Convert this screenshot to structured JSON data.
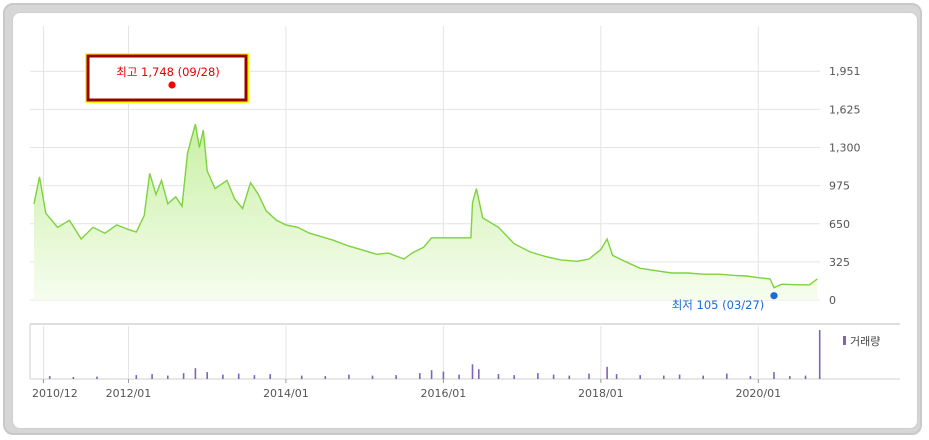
{
  "chart_data": [
    {
      "type": "area",
      "title": "",
      "xlabel": "",
      "ylabel": "",
      "ylim": [
        0,
        1951
      ],
      "y_ticks": [
        "1,951",
        "1,625",
        "1,300",
        "975",
        "650",
        "325",
        "0"
      ],
      "y_tick_values": [
        1951,
        1625,
        1300,
        975,
        650,
        325,
        0
      ],
      "grid": true,
      "colors": {
        "line": "#7ed23e",
        "fill_top": "#c9f0a4",
        "fill_bottom": "#f6fdef",
        "grid": "#e4e4e4"
      },
      "series": [
        {
          "values": [
            [
              2010.8,
              820
            ],
            [
              2010.87,
              1050
            ],
            [
              2010.95,
              740
            ],
            [
              2011.1,
              620
            ],
            [
              2011.25,
              680
            ],
            [
              2011.4,
              520
            ],
            [
              2011.55,
              620
            ],
            [
              2011.7,
              570
            ],
            [
              2011.85,
              640
            ],
            [
              2012.0,
              600
            ],
            [
              2012.1,
              580
            ],
            [
              2012.2,
              720
            ],
            [
              2012.27,
              1080
            ],
            [
              2012.35,
              900
            ],
            [
              2012.42,
              1020
            ],
            [
              2012.5,
              820
            ],
            [
              2012.6,
              880
            ],
            [
              2012.68,
              800
            ],
            [
              2012.75,
              1250
            ],
            [
              2012.8,
              1380
            ],
            [
              2012.85,
              1500
            ],
            [
              2012.9,
              1300
            ],
            [
              2012.95,
              1450
            ],
            [
              2013.0,
              1100
            ],
            [
              2013.1,
              950
            ],
            [
              2013.25,
              1020
            ],
            [
              2013.35,
              860
            ],
            [
              2013.45,
              780
            ],
            [
              2013.55,
              1000
            ],
            [
              2013.65,
              900
            ],
            [
              2013.75,
              760
            ],
            [
              2013.88,
              680
            ],
            [
              2014.0,
              640
            ],
            [
              2014.15,
              620
            ],
            [
              2014.3,
              570
            ],
            [
              2014.45,
              540
            ],
            [
              2014.6,
              510
            ],
            [
              2014.8,
              460
            ],
            [
              2015.0,
              420
            ],
            [
              2015.15,
              390
            ],
            [
              2015.3,
              400
            ],
            [
              2015.5,
              350
            ],
            [
              2015.6,
              400
            ],
            [
              2015.75,
              450
            ],
            [
              2015.85,
              530
            ],
            [
              2016.0,
              530
            ],
            [
              2016.2,
              530
            ],
            [
              2016.35,
              530
            ],
            [
              2016.37,
              830
            ],
            [
              2016.42,
              950
            ],
            [
              2016.5,
              700
            ],
            [
              2016.7,
              620
            ],
            [
              2016.9,
              480
            ],
            [
              2017.1,
              410
            ],
            [
              2017.3,
              370
            ],
            [
              2017.5,
              340
            ],
            [
              2017.7,
              330
            ],
            [
              2017.85,
              350
            ],
            [
              2018.0,
              430
            ],
            [
              2018.08,
              520
            ],
            [
              2018.15,
              380
            ],
            [
              2018.3,
              330
            ],
            [
              2018.5,
              270
            ],
            [
              2018.7,
              250
            ],
            [
              2018.9,
              230
            ],
            [
              2019.1,
              230
            ],
            [
              2019.3,
              220
            ],
            [
              2019.5,
              220
            ],
            [
              2019.7,
              210
            ],
            [
              2019.85,
              205
            ],
            [
              2020.0,
              190
            ],
            [
              2020.15,
              180
            ],
            [
              2020.2,
              105
            ],
            [
              2020.3,
              135
            ],
            [
              2020.5,
              130
            ],
            [
              2020.65,
              130
            ],
            [
              2020.75,
              180
            ]
          ]
        }
      ],
      "annotations": [
        {
          "text": "최고 1,748 (09/28)",
          "x": 2012.83,
          "y": 1748,
          "color": "#e60000"
        },
        {
          "text": "최저 105 (03/27)",
          "x": 2020.2,
          "y": 105,
          "color": "#1a6bd6"
        }
      ]
    },
    {
      "type": "bar",
      "title": "",
      "xlabel": "",
      "ylabel": "",
      "legend": "거래량",
      "legend_placement": "top-right",
      "grid": true,
      "colors": {
        "bar": "#7f63b5"
      },
      "x_ticks": [
        "2010/12",
        "2012/01",
        "2014/01",
        "2016/01",
        "2018/01",
        "2020/01"
      ],
      "x_tick_values": [
        2010.92,
        2012.0,
        2014.0,
        2016.0,
        2018.0,
        2020.0
      ],
      "xlim": [
        2010.8,
        2021.8
      ],
      "series": [
        {
          "values": [
            [
              2011.0,
              6
            ],
            [
              2011.3,
              4
            ],
            [
              2011.6,
              5
            ],
            [
              2012.1,
              8
            ],
            [
              2012.3,
              10
            ],
            [
              2012.5,
              7
            ],
            [
              2012.7,
              12
            ],
            [
              2012.85,
              22
            ],
            [
              2013.0,
              14
            ],
            [
              2013.2,
              9
            ],
            [
              2013.4,
              11
            ],
            [
              2013.6,
              8
            ],
            [
              2013.8,
              10
            ],
            [
              2014.2,
              7
            ],
            [
              2014.5,
              6
            ],
            [
              2014.8,
              9
            ],
            [
              2015.1,
              7
            ],
            [
              2015.4,
              8
            ],
            [
              2015.7,
              12
            ],
            [
              2015.85,
              18
            ],
            [
              2016.0,
              15
            ],
            [
              2016.2,
              9
            ],
            [
              2016.37,
              30
            ],
            [
              2016.45,
              20
            ],
            [
              2016.7,
              10
            ],
            [
              2016.9,
              8
            ],
            [
              2017.2,
              12
            ],
            [
              2017.4,
              9
            ],
            [
              2017.6,
              7
            ],
            [
              2017.85,
              11
            ],
            [
              2018.08,
              25
            ],
            [
              2018.2,
              10
            ],
            [
              2018.5,
              8
            ],
            [
              2018.8,
              7
            ],
            [
              2019.0,
              9
            ],
            [
              2019.3,
              7
            ],
            [
              2019.6,
              11
            ],
            [
              2019.9,
              6
            ],
            [
              2020.2,
              14
            ],
            [
              2020.4,
              6
            ],
            [
              2020.6,
              7
            ],
            [
              2020.78,
              100
            ]
          ]
        }
      ]
    }
  ]
}
